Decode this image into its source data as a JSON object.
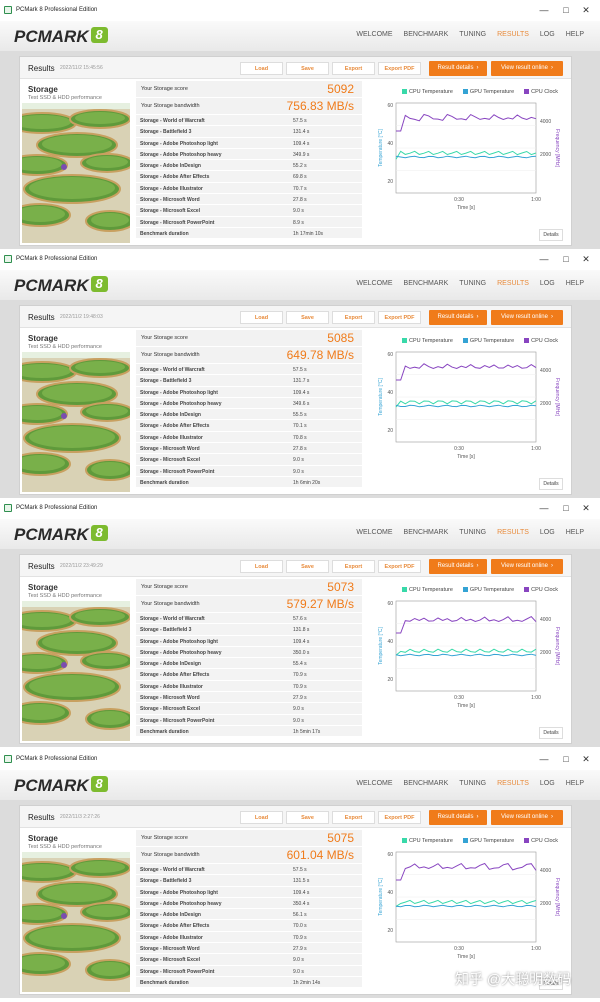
{
  "window_title": "PCMark 8 Professional Edition",
  "window_buttons": [
    "—",
    "□",
    "✕"
  ],
  "logo_text": "PCMARK",
  "logo_number": "8",
  "nav": [
    "WELCOME",
    "BENCHMARK",
    "TUNING",
    "RESULTS",
    "LOG",
    "HELP"
  ],
  "nav_active": "RESULTS",
  "results_title": "Results",
  "buttons": {
    "load": "Load",
    "save": "Save",
    "export": "Export",
    "export_pdf": "Export PDF",
    "result_details": "Result details",
    "view_online": "View result online",
    "details": "Details",
    "arrow": "›"
  },
  "storage_title": "Storage",
  "storage_sub": "Test SSD & HDD performance",
  "score_label": "Your Storage score",
  "bandwidth_label": "Your Storage bandwidth",
  "chart_legend": [
    "CPU Temperature",
    "GPU Temperature",
    "CPU Clock"
  ],
  "chart_colors": {
    "cpu_temp": "#38d9a9",
    "gpu_temp": "#34a3d4",
    "cpu_clock": "#8845c0",
    "accent": "#f07b1a"
  },
  "axis": {
    "left_label": "Temperature [°C]",
    "right_label": "Frequency [MHz]",
    "x_label": "Time [s]",
    "x_ticks": [
      "0:30",
      "1:00"
    ],
    "left_ticks": [
      "60",
      "40",
      "20"
    ],
    "right_ticks": [
      "4000",
      "2000"
    ]
  },
  "benchmarks": [
    "Storage - World of Warcraft",
    "Storage - Battlefield 3",
    "Storage - Adobe Photoshop light",
    "Storage - Adobe Photoshop heavy",
    "Storage - Adobe InDesign",
    "Storage - Adobe After Effects",
    "Storage - Adobe Illustrator",
    "Storage - Microsoft Word",
    "Storage - Microsoft Excel",
    "Storage - Microsoft PowerPoint",
    "Benchmark duration"
  ],
  "runs": [
    {
      "date": "2022/11/2 15:45:56",
      "score": "5092",
      "bandwidth": "756.83 MB/s",
      "values": [
        "57.5 s",
        "131.4 s",
        "109.4 s",
        "349.9 s",
        "55.2 s",
        "69.8 s",
        "70.7 s",
        "27.8 s",
        "9.0 s",
        "8.9 s",
        "1h 17min 10s"
      ]
    },
    {
      "date": "2022/11/2 19:48:03",
      "score": "5085",
      "bandwidth": "649.78 MB/s",
      "values": [
        "57.5 s",
        "131.7 s",
        "109.4 s",
        "349.6 s",
        "55.5 s",
        "70.1 s",
        "70.8 s",
        "27.8 s",
        "9.0 s",
        "9.0 s",
        "1h 6min 20s"
      ]
    },
    {
      "date": "2022/11/2 23:49:29",
      "score": "5073",
      "bandwidth": "579.27 MB/s",
      "values": [
        "57.6 s",
        "131.8 s",
        "109.4 s",
        "350.0 s",
        "55.4 s",
        "70.9 s",
        "70.9 s",
        "27.9 s",
        "9.0 s",
        "9.0 s",
        "1h 5min 17s"
      ]
    },
    {
      "date": "2022/11/3 2:27:26",
      "score": "5075",
      "bandwidth": "601.04 MB/s",
      "values": [
        "57.5 s",
        "131.5 s",
        "109.4 s",
        "350.4 s",
        "56.1 s",
        "70.0 s",
        "70.9 s",
        "27.9 s",
        "9.0 s",
        "9.0 s",
        "1h 2min 14s"
      ]
    }
  ],
  "watermark": "知乎 @大聪明数码"
}
